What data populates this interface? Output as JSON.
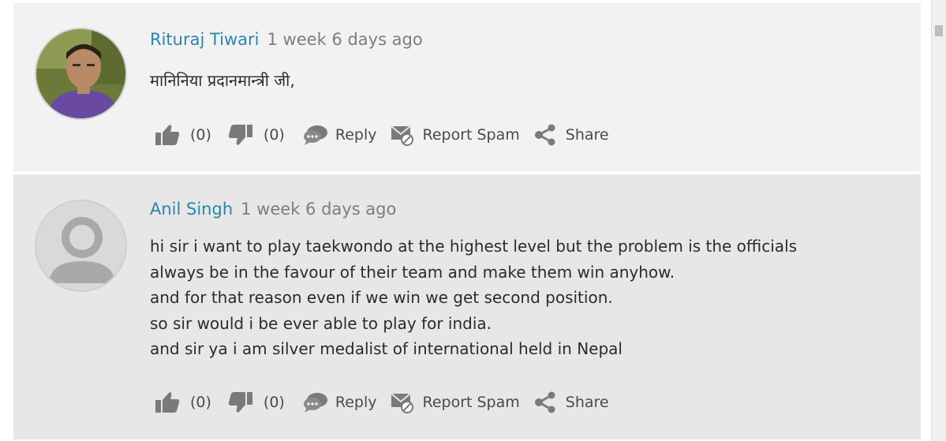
{
  "comments": [
    {
      "author": "Rituraj Tiwari",
      "time": "1 week 6 days ago",
      "lines": [
        "मानिनिया प्रदानमान्त्री जी,"
      ],
      "likes": "(0)",
      "dislikes": "(0)",
      "reply": "Reply",
      "report": "Report Spam",
      "share": "Share"
    },
    {
      "author": "Anil Singh",
      "time": "1 week 6 days ago",
      "lines": [
        "hi sir i want to play taekwondo at the highest level but the problem is the officials",
        "always be in the favour of their team and make them win anyhow.",
        "and for that reason even if we win we get second position.",
        "so sir would i be ever able to play for india.",
        "and sir ya i am silver medalist of international held in Nepal"
      ],
      "likes": "(0)",
      "dislikes": "(0)",
      "reply": "Reply",
      "report": "Report Spam",
      "share": "Share"
    }
  ],
  "colors": {
    "author": "#2a86a8",
    "timestamp": "#7d7d7d",
    "icon": "#7a7a7a",
    "comment1_bg": "#f2f2f2",
    "comment2_bg": "#e7e7e7"
  },
  "icons": [
    "thumbs-up-icon",
    "thumbs-down-icon",
    "speech-bubble-icon",
    "spam-envelope-icon",
    "share-icon",
    "avatar-placeholder-icon"
  ]
}
